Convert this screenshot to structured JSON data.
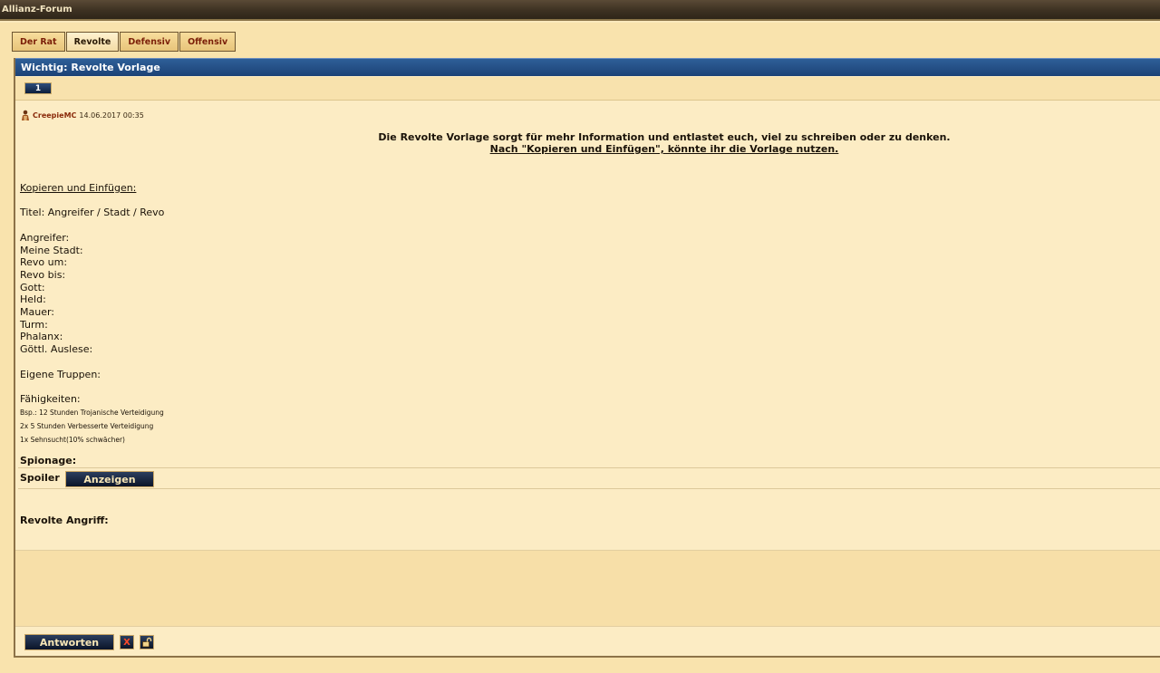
{
  "window": {
    "title": "Allianz-Forum"
  },
  "tabs": [
    {
      "label": "Der Rat"
    },
    {
      "label": "Revolte"
    },
    {
      "label": "Defensiv"
    },
    {
      "label": "Offensiv"
    }
  ],
  "thread": {
    "title": "Wichtig: Revolte Vorlage",
    "page": "1"
  },
  "post": {
    "author": "CreepieMC",
    "date": "14.06.2017 00:35",
    "intro_line1": "Die Revolte Vorlage sorgt für mehr Information und entlastet euch, viel zu schreiben oder zu denken.",
    "intro_line2": "Nach \"Kopieren und Einfügen\", könnte ihr die Vorlage nutzen.",
    "copy_heading": "Kopieren und Einfügen:",
    "template_title": "Titel: Angreifer / Stadt / Revo",
    "fields": [
      "Angreifer:",
      "Meine Stadt:",
      "Revo um:",
      "Revo bis:",
      "Gott:",
      "Held:",
      "Mauer:",
      "Turm:",
      "Phalanx:",
      "Göttl. Auslese:"
    ],
    "own_troops": "Eigene Truppen:",
    "abilities": "Fähigkeiten:",
    "ability_examples": [
      "Bsp.: 12 Stunden Trojanische Verteidigung",
      "2x 5 Stunden Verbesserte Verteidigung",
      "1x Sehnsucht(10% schwächer)"
    ],
    "spionage": "Spionage:",
    "spoiler_label": "Spoiler",
    "spoiler_button": "Anzeigen",
    "revolt_attack": "Revolte Angriff:"
  },
  "footer": {
    "reply_button": "Antworten",
    "close_icon_label": "X"
  },
  "colors": {
    "header_blue": "#1c4276",
    "parchment": "#fcecc4",
    "author_red": "#8a2a0a"
  }
}
